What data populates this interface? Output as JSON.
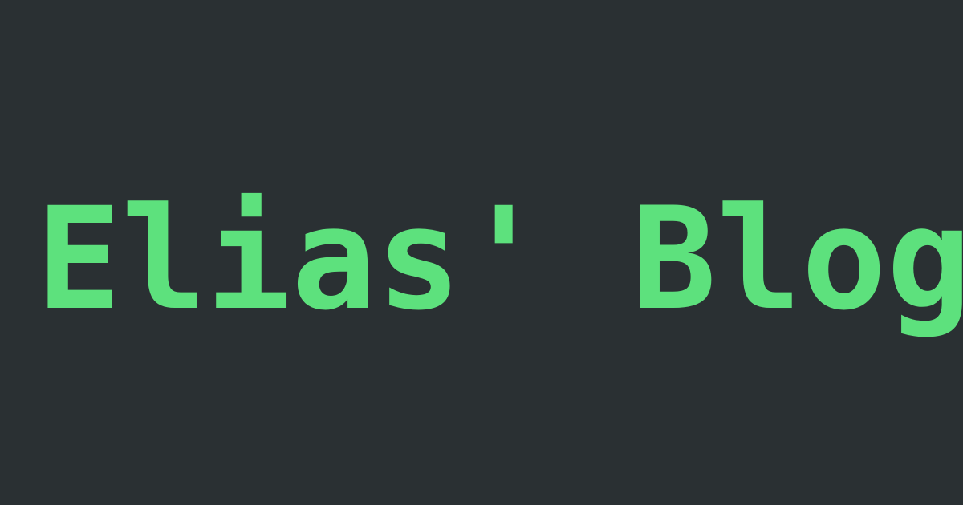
{
  "card": {
    "title": "Elias' Blog",
    "background_color": "#2a3033",
    "text_color": "#5de17d"
  }
}
